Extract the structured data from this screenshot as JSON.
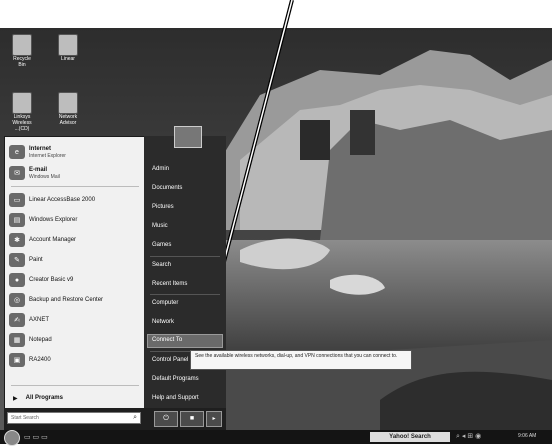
{
  "desktop": {
    "icons": [
      {
        "label": "Recycle Bin"
      },
      {
        "label": "Linear"
      },
      {
        "label": "Linksys Wireless ...(CD)"
      },
      {
        "label": "Network Advisor"
      }
    ]
  },
  "start_menu": {
    "pinned": [
      {
        "title": "Internet",
        "subtitle": "Internet Explorer"
      },
      {
        "title": "E-mail",
        "subtitle": "Windows Mail"
      }
    ],
    "recent": [
      {
        "label": "Linear AccessBase 2000"
      },
      {
        "label": "Windows Explorer"
      },
      {
        "label": "Account Manager"
      },
      {
        "label": "Paint"
      },
      {
        "label": "Creator Basic v9"
      },
      {
        "label": "Backup and Restore Center"
      },
      {
        "label": "AXNET"
      },
      {
        "label": "Notepad"
      },
      {
        "label": "RA2400"
      }
    ],
    "all_programs": "All Programs",
    "search_placeholder": "Start Search",
    "right_items": [
      {
        "label": "Admin"
      },
      {
        "label": "Documents"
      },
      {
        "label": "Pictures"
      },
      {
        "label": "Music"
      },
      {
        "label": "Games"
      },
      {
        "label": "Search"
      },
      {
        "label": "Recent Items"
      },
      {
        "label": "Computer"
      },
      {
        "label": "Network"
      },
      {
        "label": "Connect To"
      },
      {
        "label": "Control Panel"
      },
      {
        "label": "Default Programs"
      },
      {
        "label": "Help and Support"
      }
    ],
    "tooltip": "See the available wireless networks, dial-up, and VPN connections that you can connect to."
  },
  "taskbar": {
    "search_label": "Yahoo! Search",
    "clock": "9:06 AM"
  }
}
